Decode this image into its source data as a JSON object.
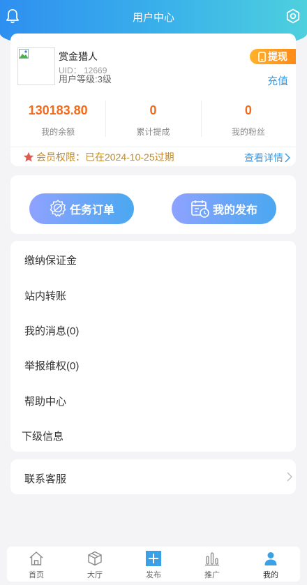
{
  "header": {
    "title": "用户中心"
  },
  "profile": {
    "username": "赏金猎人",
    "uid": "UID：  12669",
    "level": "用户等级:3级",
    "withdraw_label": "提现",
    "recharge_label": "充值"
  },
  "stats": [
    {
      "value": "130183.80",
      "label": "我的余额"
    },
    {
      "value": "0",
      "label": "累计提成"
    },
    {
      "value": "0",
      "label": "我的粉丝"
    }
  ],
  "vip": {
    "text": "会员权限：已在2024-10-25过期",
    "detail_label": "查看详情"
  },
  "actions": {
    "tasks_label": "任务订单",
    "publish_label": "我的发布"
  },
  "menu": [
    {
      "label": "缴纳保证金"
    },
    {
      "label": "站内转账"
    },
    {
      "label": "我的消息(0)"
    },
    {
      "label": "举报维权(0)"
    },
    {
      "label": "帮助中心"
    },
    {
      "label": "下级信息"
    }
  ],
  "service": {
    "label": "联系客服"
  },
  "tabbar": [
    {
      "label": "首页",
      "icon": "home-icon"
    },
    {
      "label": "大厅",
      "icon": "cube-icon"
    },
    {
      "label": "发布",
      "icon": "plus-icon"
    },
    {
      "label": "推广",
      "icon": "bar-chart-icon"
    },
    {
      "label": "我的",
      "icon": "user-icon"
    }
  ],
  "colors": {
    "accent": "#3a9ee8",
    "balance": "#f26a1b",
    "vip": "#c28a26",
    "withdraw": "#ff9a1f"
  }
}
